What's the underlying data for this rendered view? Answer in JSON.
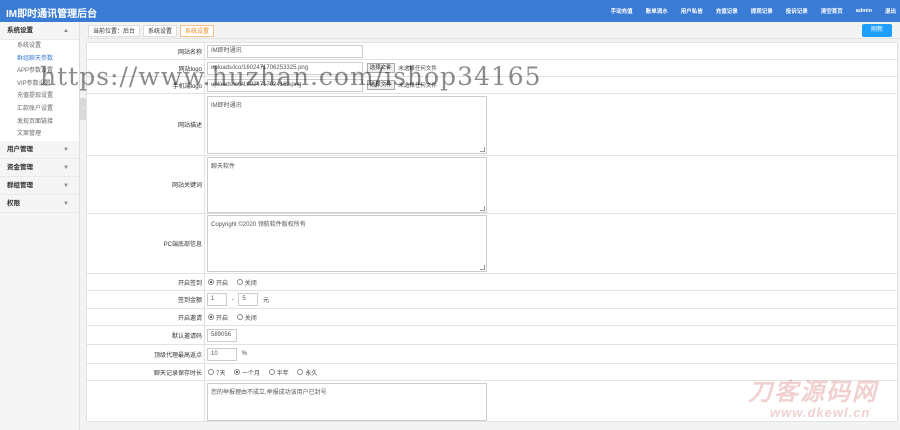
{
  "app": {
    "title": "IM即时通讯管理后台",
    "nav": [
      "手动充值",
      "账单流水",
      "用户私信",
      "充值记录",
      "提现记录",
      "投诉记录",
      "清空首页",
      "admin",
      "退出"
    ]
  },
  "sidebar": {
    "groups": [
      {
        "label": "系统设置",
        "expanded": true,
        "items": [
          "系统设置",
          "群组聊天参数",
          "APP参数设置",
          "VIP参数设置",
          "充值提现设置",
          "汇款账户设置",
          "发现页面链接",
          "文案管理"
        ],
        "active_index": 1
      },
      {
        "label": "用户管理",
        "expanded": false
      },
      {
        "label": "资金管理",
        "expanded": false
      },
      {
        "label": "群组管理",
        "expanded": false
      },
      {
        "label": "权限",
        "expanded": false
      }
    ],
    "collapse_glyph": "‹"
  },
  "breadcrumb": {
    "items": [
      "当前位置：后台",
      "系统设置",
      "系统设置"
    ],
    "active_index": 2,
    "refresh_label": "刷新"
  },
  "form": {
    "site_name": {
      "label": "网站名称",
      "value": "IM即时通讯"
    },
    "pc_logo": {
      "label": "网站logo",
      "value": "uploads/ico/1602471706253325.png",
      "button": "选择文件",
      "status": "未选择任何文件"
    },
    "mobile_logo": {
      "label": "手机端logo",
      "value": "uploads/ico/16024717024162.png",
      "button": "选择文件",
      "status": "未选择任何文件"
    },
    "site_desc": {
      "label": "网站描述",
      "value": "IM即时通讯"
    },
    "site_keywords": {
      "label": "网站关键词",
      "value": "聊天软件"
    },
    "pc_footer": {
      "label": "PC端底部信息",
      "value": "Copyright ©2020  领航软件版权所有"
    },
    "signin_open": {
      "label": "开启签到",
      "options": [
        "开启",
        "关闭"
      ],
      "selected": 0
    },
    "signin_amount": {
      "label": "签到金额",
      "min": "1",
      "sep": "-",
      "max": "5",
      "unit": "元"
    },
    "invite_open": {
      "label": "开启邀请",
      "options": [
        "开启",
        "关闭"
      ],
      "selected": 0
    },
    "default_invite_code": {
      "label": "默认邀请码",
      "value": "589056"
    },
    "top_agent_rebate": {
      "label": "顶级代理最高返点",
      "value": "10",
      "unit": "%"
    },
    "chat_retention": {
      "label": "聊天记录保存时长",
      "options": [
        "7天",
        "一个月",
        "半年",
        "永久"
      ],
      "selected": 1
    },
    "reject_notice": {
      "label": "",
      "value": "您的举报理由不成立,举报成功该用户已封号"
    }
  },
  "watermarks": {
    "url_text": "https://www.huzhan.com/ishop34165",
    "logo_text": "刀客源码网",
    "site_text": "www.dkewl.cn"
  },
  "colors": {
    "topbar": "#3a7bd5",
    "active_menu": "#3a7bd5",
    "active_crumb": "#f08a24",
    "refresh_button": "#1e9fff"
  },
  "icons": {
    "expand_arrow": "▲",
    "collapse_arrow": "▼"
  }
}
